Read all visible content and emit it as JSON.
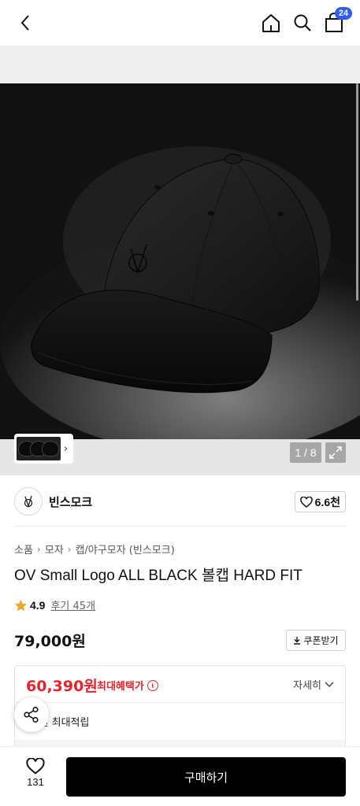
{
  "header": {
    "back_icon": "chevron-left-icon",
    "home_icon": "home-icon",
    "search_icon": "search-icon",
    "cart_icon": "shopping-bag-icon",
    "cart_count": "24"
  },
  "gallery": {
    "counter": "1 / 8",
    "expand_icon": "expand-icon",
    "thumb_chevron_icon": "chevron-right-icon"
  },
  "brand": {
    "name": "빈스모크",
    "like_count": "6.6천",
    "like_icon": "heart-outline-icon"
  },
  "breadcrumb": [
    "소품",
    "모자",
    "캡/야구모자 (빈스모크)"
  ],
  "product": {
    "title": "OV Small Logo ALL BLACK 볼캡 HARD FIT",
    "rating": "4.9",
    "reviews": "후기 45개",
    "price": "79,000원",
    "coupon_label": "쿠폰받기"
  },
  "benefit": {
    "sale_price": "60,390원",
    "max_label": "최대혜택가",
    "detail_label": "자세히",
    "point_text": "60원 최대적립"
  },
  "bottom": {
    "wish_count": "131",
    "buy_label": "구매하기"
  },
  "colors": {
    "accent_red": "#e6222b",
    "badge_blue": "#2f5cf5",
    "star": "#f5a623"
  }
}
